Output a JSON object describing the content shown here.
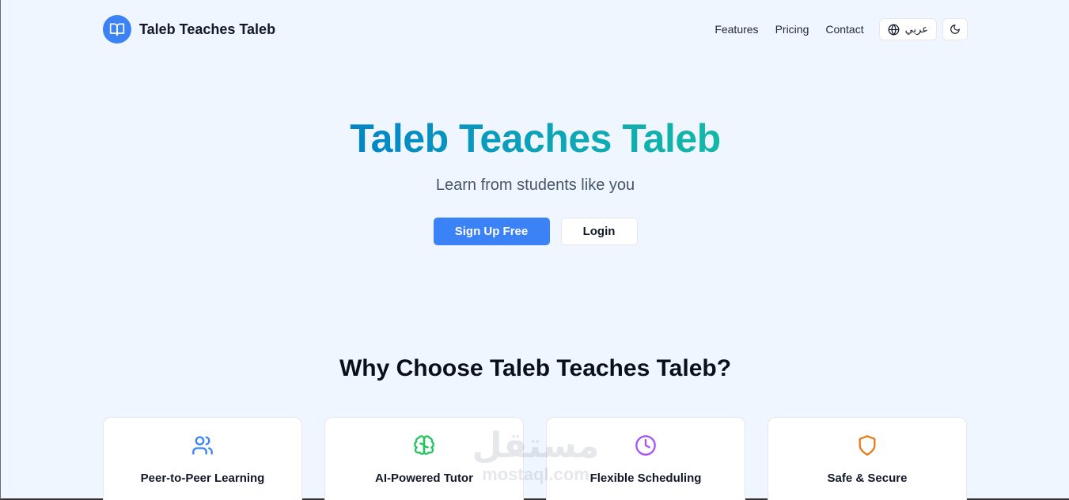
{
  "brand": {
    "name": "Taleb Teaches Taleb",
    "logo_icon": "book-open-icon",
    "logo_color": "#3b82f6"
  },
  "nav": {
    "links": [
      "Features",
      "Pricing",
      "Contact"
    ],
    "language_button": {
      "label": "عربي",
      "icon": "globe-icon"
    },
    "theme_button": {
      "icon": "moon-icon"
    }
  },
  "hero": {
    "title": "Taleb Teaches Taleb",
    "subtitle": "Learn from students like you",
    "primary_button": "Sign Up Free",
    "secondary_button": "Login",
    "accent_color": "#3b82f6"
  },
  "features": {
    "heading": "Why Choose Taleb Teaches Taleb?",
    "cards": [
      {
        "title": "Peer-to-Peer Learning",
        "icon": "users-icon",
        "color": "#3b82f6"
      },
      {
        "title": "AI-Powered Tutor",
        "icon": "brain-icon",
        "color": "#22c55e"
      },
      {
        "title": "Flexible Scheduling",
        "icon": "clock-icon",
        "color": "#a855f7"
      },
      {
        "title": "Safe & Secure",
        "icon": "shield-icon",
        "color": "#ea7a1a"
      }
    ]
  },
  "watermark": {
    "arabic": "مستقل",
    "latin": "mostaql.com"
  }
}
